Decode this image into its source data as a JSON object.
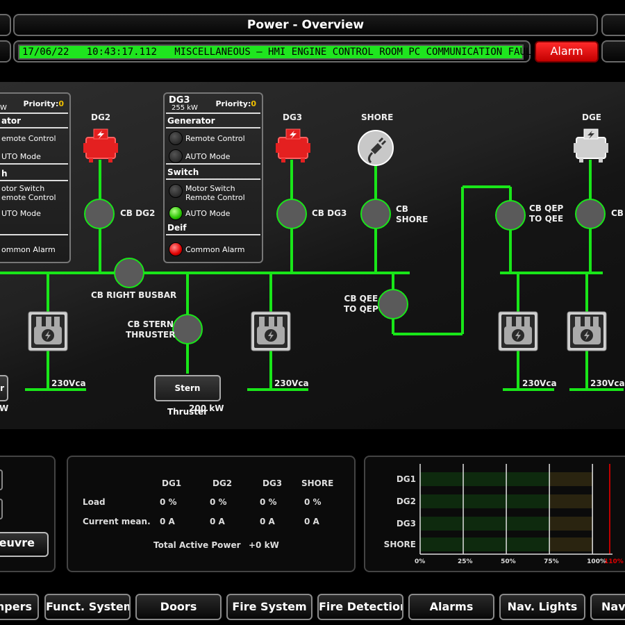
{
  "header": {
    "title": "Power - Overview"
  },
  "alarm": {
    "date": "17/06/22",
    "time": "10:43:17.112",
    "message": "MISCELLANEOUS – HMI ENGINE CONTROL ROOM PC COMMUNICATION FAULT",
    "button_label": "Alarm",
    "bar_color": "#1fe51f"
  },
  "panels": {
    "left": {
      "sub": "W",
      "priority_label": "Priority:",
      "priority_value": "0",
      "section1": "ator",
      "row1": "emote Control",
      "row2": "UTO Mode",
      "section2": "h",
      "row3a": "otor Switch",
      "row3b": "emote Control",
      "row4": "UTO Mode",
      "row5": "ommon Alarm"
    },
    "dg3": {
      "title": "DG3",
      "sub": "255 kW",
      "priority_label": "Priority:",
      "priority_value": "0",
      "section1": "Generator",
      "row1": "Remote Control",
      "row2": "AUTO Mode",
      "section2": "Switch",
      "row3a": "Motor Switch",
      "row3b": "Remote Control",
      "row4": "AUTO Mode",
      "section3": "Deif",
      "row5": "Common Alarm"
    }
  },
  "diagram": {
    "gen_dg2": "DG2",
    "gen_dg3": "DG3",
    "shore": "SHORE",
    "gen_dge": "DGE",
    "cb_dg2": "CB DG2",
    "cb_dg3": "CB DG3",
    "cb_shore_1": "CB",
    "cb_shore_2": "SHORE",
    "cb_qep_1": "CB QEP",
    "cb_qep_2": "TO QEE",
    "cb_dge": "CB",
    "cb_right_busbar": "CB RIGHT BUSBAR",
    "cb_qee_1": "CB QEE",
    "cb_qee_2": "TO QEP",
    "cb_stern_1": "CB STERN",
    "cb_stern_2": "THRUSTER",
    "stern_thruster": "Stern Thruster",
    "stern_power": "200 kW",
    "volt_1": "230Vca",
    "volt_2": "230Vca",
    "volt_3": "230Vca",
    "volt_4": "230Vca",
    "left_box_text": "r",
    "left_power": "W",
    "line_color": "#19e619",
    "gen_active_color": "#ff2a2a"
  },
  "left_bottom": {
    "button": "oeuvre"
  },
  "table": {
    "cols": [
      "DG1",
      "DG2",
      "DG3",
      "SHORE"
    ],
    "load_label": "Load",
    "load": [
      "0 %",
      "0 %",
      "0 %",
      "0 %"
    ],
    "current_label": "Current mean.",
    "current": [
      "0 A",
      "0 A",
      "0 A",
      "0 A"
    ],
    "total_label": "Total Active Power",
    "total_value": "+0 kW"
  },
  "chart_data": {
    "type": "bar",
    "categories": [
      "DG1",
      "DG2",
      "DG3",
      "SHORE"
    ],
    "values": [
      0,
      0,
      0,
      0
    ],
    "ticks": [
      "0%",
      "25%",
      "50%",
      "75%",
      "100%",
      "110%"
    ],
    "xlim": [
      0,
      110
    ]
  },
  "nav": {
    "items": [
      "mpers",
      "Funct. Systems",
      "Doors",
      "Fire System",
      "Fire Detection",
      "Alarms",
      "Nav. Lights",
      "Nav."
    ]
  }
}
